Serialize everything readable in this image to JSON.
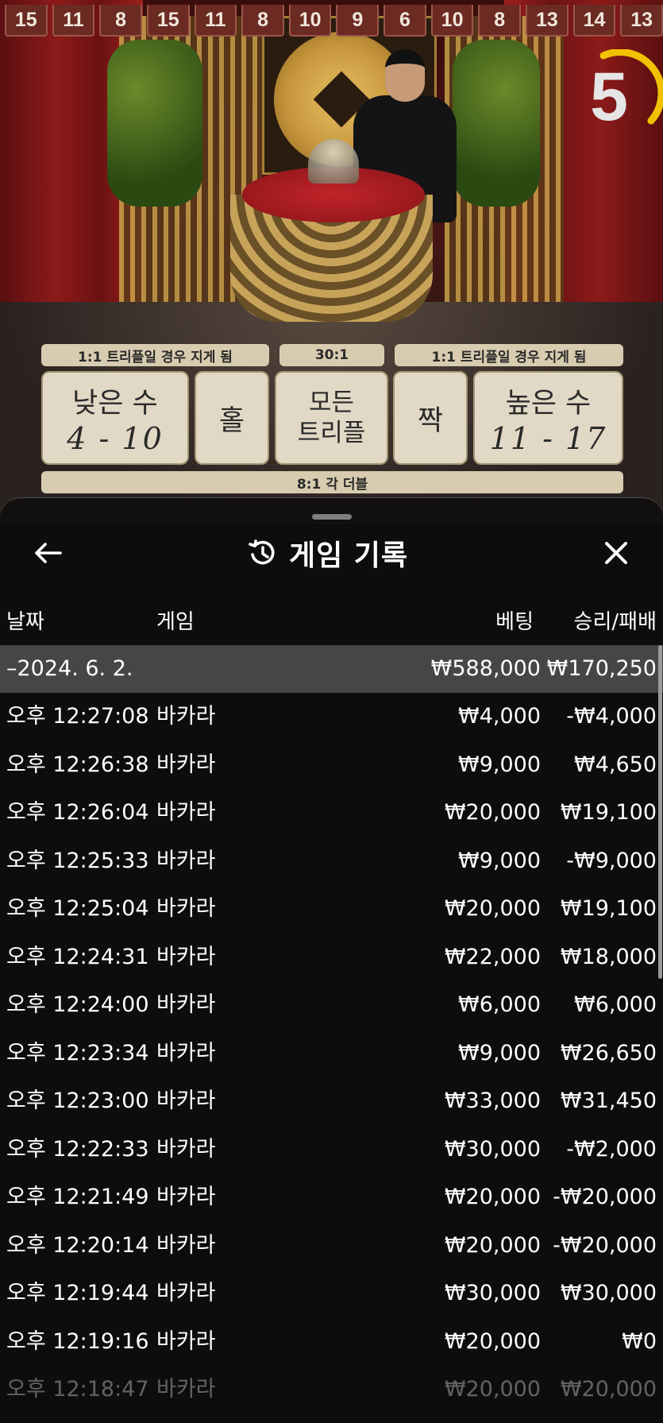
{
  "number_strip": [
    "15",
    "11",
    "8",
    "15",
    "11",
    "8",
    "10",
    "9",
    "6",
    "10",
    "8",
    "13",
    "14",
    "13"
  ],
  "countdown": {
    "value": "5",
    "color": "#f2c200"
  },
  "board": {
    "payout_low": "1:1 트리플일 경우 지게 됨",
    "payout_triple": "30:1",
    "payout_high": "1:1 트리플일 경우 지게 됨",
    "low_label": "낮은 수",
    "low_range": "4 - 10",
    "odd_label": "홀",
    "any_triple_line1": "모든",
    "any_triple_line2": "트리플",
    "even_label": "짝",
    "high_label": "높은 수",
    "high_range": "11 - 17",
    "double_payout": "8:1 각 더블"
  },
  "history": {
    "title": "게임 기록",
    "icons": {
      "back": "arrow-left-icon",
      "history": "history-clock-icon",
      "close": "close-icon"
    },
    "columns": {
      "date": "날짜",
      "game": "게임",
      "bet": "베팅",
      "result": "승리/패배"
    },
    "summary": {
      "date": "–2024. 6. 2.",
      "bet": "₩588,000",
      "result": "₩170,250"
    },
    "rows": [
      {
        "date": "오후 12:27:08",
        "game": "바카라",
        "bet": "₩4,000",
        "result": "-₩4,000"
      },
      {
        "date": "오후 12:26:38",
        "game": "바카라",
        "bet": "₩9,000",
        "result": "₩4,650"
      },
      {
        "date": "오후 12:26:04",
        "game": "바카라",
        "bet": "₩20,000",
        "result": "₩19,100"
      },
      {
        "date": "오후 12:25:33",
        "game": "바카라",
        "bet": "₩9,000",
        "result": "-₩9,000"
      },
      {
        "date": "오후 12:25:04",
        "game": "바카라",
        "bet": "₩20,000",
        "result": "₩19,100"
      },
      {
        "date": "오후 12:24:31",
        "game": "바카라",
        "bet": "₩22,000",
        "result": "₩18,000"
      },
      {
        "date": "오후 12:24:00",
        "game": "바카라",
        "bet": "₩6,000",
        "result": "₩6,000"
      },
      {
        "date": "오후 12:23:34",
        "game": "바카라",
        "bet": "₩9,000",
        "result": "₩26,650"
      },
      {
        "date": "오후 12:23:00",
        "game": "바카라",
        "bet": "₩33,000",
        "result": "₩31,450"
      },
      {
        "date": "오후 12:22:33",
        "game": "바카라",
        "bet": "₩30,000",
        "result": "-₩2,000"
      },
      {
        "date": "오후 12:21:49",
        "game": "바카라",
        "bet": "₩20,000",
        "result": "-₩20,000"
      },
      {
        "date": "오후 12:20:14",
        "game": "바카라",
        "bet": "₩20,000",
        "result": "-₩20,000"
      },
      {
        "date": "오후 12:19:44",
        "game": "바카라",
        "bet": "₩30,000",
        "result": "₩30,000"
      },
      {
        "date": "오후 12:19:16",
        "game": "바카라",
        "bet": "₩20,000",
        "result": "₩0"
      },
      {
        "date": "오후 12:18:47",
        "game": "바카라",
        "bet": "₩20,000",
        "result": "₩20,000"
      }
    ]
  }
}
